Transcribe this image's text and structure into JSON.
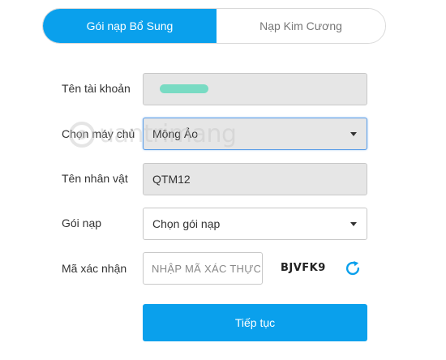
{
  "tabs": [
    {
      "label": "Gói nạp Bổ Sung",
      "active": true
    },
    {
      "label": "Nạp Kim Cương",
      "active": false
    }
  ],
  "form": {
    "account": {
      "label": "Tên tài khoản"
    },
    "server": {
      "label": "Chọn máy chủ",
      "value": "Mộng Ảo"
    },
    "character": {
      "label": "Tên nhân vật",
      "value": "QTM12"
    },
    "package": {
      "label": "Gói nạp",
      "value": "Chọn gói nạp"
    },
    "captcha": {
      "label": "Mã xác nhận",
      "placeholder": "NHẬP MÃ XÁC THỰC",
      "code": "BJVFK9"
    }
  },
  "submit_label": "Tiếp tục",
  "watermark": {
    "text": "uantrimang"
  },
  "colors": {
    "accent": "#0aa0ec",
    "readonly_bg": "#e6e6e6",
    "focus_border": "#5b9ee8"
  }
}
